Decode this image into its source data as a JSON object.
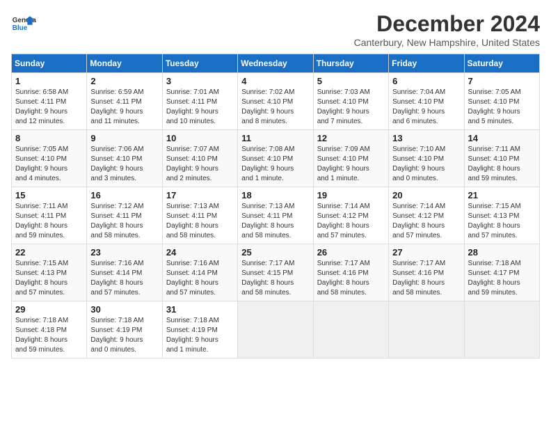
{
  "logo": {
    "line1": "General",
    "line2": "Blue"
  },
  "title": "December 2024",
  "subtitle": "Canterbury, New Hampshire, United States",
  "days_header": [
    "Sunday",
    "Monday",
    "Tuesday",
    "Wednesday",
    "Thursday",
    "Friday",
    "Saturday"
  ],
  "weeks": [
    [
      {
        "day": "1",
        "info": "Sunrise: 6:58 AM\nSunset: 4:11 PM\nDaylight: 9 hours\nand 12 minutes."
      },
      {
        "day": "2",
        "info": "Sunrise: 6:59 AM\nSunset: 4:11 PM\nDaylight: 9 hours\nand 11 minutes."
      },
      {
        "day": "3",
        "info": "Sunrise: 7:01 AM\nSunset: 4:11 PM\nDaylight: 9 hours\nand 10 minutes."
      },
      {
        "day": "4",
        "info": "Sunrise: 7:02 AM\nSunset: 4:10 PM\nDaylight: 9 hours\nand 8 minutes."
      },
      {
        "day": "5",
        "info": "Sunrise: 7:03 AM\nSunset: 4:10 PM\nDaylight: 9 hours\nand 7 minutes."
      },
      {
        "day": "6",
        "info": "Sunrise: 7:04 AM\nSunset: 4:10 PM\nDaylight: 9 hours\nand 6 minutes."
      },
      {
        "day": "7",
        "info": "Sunrise: 7:05 AM\nSunset: 4:10 PM\nDaylight: 9 hours\nand 5 minutes."
      }
    ],
    [
      {
        "day": "8",
        "info": "Sunrise: 7:05 AM\nSunset: 4:10 PM\nDaylight: 9 hours\nand 4 minutes."
      },
      {
        "day": "9",
        "info": "Sunrise: 7:06 AM\nSunset: 4:10 PM\nDaylight: 9 hours\nand 3 minutes."
      },
      {
        "day": "10",
        "info": "Sunrise: 7:07 AM\nSunset: 4:10 PM\nDaylight: 9 hours\nand 2 minutes."
      },
      {
        "day": "11",
        "info": "Sunrise: 7:08 AM\nSunset: 4:10 PM\nDaylight: 9 hours\nand 1 minute."
      },
      {
        "day": "12",
        "info": "Sunrise: 7:09 AM\nSunset: 4:10 PM\nDaylight: 9 hours\nand 1 minute."
      },
      {
        "day": "13",
        "info": "Sunrise: 7:10 AM\nSunset: 4:10 PM\nDaylight: 9 hours\nand 0 minutes."
      },
      {
        "day": "14",
        "info": "Sunrise: 7:11 AM\nSunset: 4:10 PM\nDaylight: 8 hours\nand 59 minutes."
      }
    ],
    [
      {
        "day": "15",
        "info": "Sunrise: 7:11 AM\nSunset: 4:11 PM\nDaylight: 8 hours\nand 59 minutes."
      },
      {
        "day": "16",
        "info": "Sunrise: 7:12 AM\nSunset: 4:11 PM\nDaylight: 8 hours\nand 58 minutes."
      },
      {
        "day": "17",
        "info": "Sunrise: 7:13 AM\nSunset: 4:11 PM\nDaylight: 8 hours\nand 58 minutes."
      },
      {
        "day": "18",
        "info": "Sunrise: 7:13 AM\nSunset: 4:11 PM\nDaylight: 8 hours\nand 58 minutes."
      },
      {
        "day": "19",
        "info": "Sunrise: 7:14 AM\nSunset: 4:12 PM\nDaylight: 8 hours\nand 57 minutes."
      },
      {
        "day": "20",
        "info": "Sunrise: 7:14 AM\nSunset: 4:12 PM\nDaylight: 8 hours\nand 57 minutes."
      },
      {
        "day": "21",
        "info": "Sunrise: 7:15 AM\nSunset: 4:13 PM\nDaylight: 8 hours\nand 57 minutes."
      }
    ],
    [
      {
        "day": "22",
        "info": "Sunrise: 7:15 AM\nSunset: 4:13 PM\nDaylight: 8 hours\nand 57 minutes."
      },
      {
        "day": "23",
        "info": "Sunrise: 7:16 AM\nSunset: 4:14 PM\nDaylight: 8 hours\nand 57 minutes."
      },
      {
        "day": "24",
        "info": "Sunrise: 7:16 AM\nSunset: 4:14 PM\nDaylight: 8 hours\nand 57 minutes."
      },
      {
        "day": "25",
        "info": "Sunrise: 7:17 AM\nSunset: 4:15 PM\nDaylight: 8 hours\nand 58 minutes."
      },
      {
        "day": "26",
        "info": "Sunrise: 7:17 AM\nSunset: 4:16 PM\nDaylight: 8 hours\nand 58 minutes."
      },
      {
        "day": "27",
        "info": "Sunrise: 7:17 AM\nSunset: 4:16 PM\nDaylight: 8 hours\nand 58 minutes."
      },
      {
        "day": "28",
        "info": "Sunrise: 7:18 AM\nSunset: 4:17 PM\nDaylight: 8 hours\nand 59 minutes."
      }
    ],
    [
      {
        "day": "29",
        "info": "Sunrise: 7:18 AM\nSunset: 4:18 PM\nDaylight: 8 hours\nand 59 minutes."
      },
      {
        "day": "30",
        "info": "Sunrise: 7:18 AM\nSunset: 4:19 PM\nDaylight: 9 hours\nand 0 minutes."
      },
      {
        "day": "31",
        "info": "Sunrise: 7:18 AM\nSunset: 4:19 PM\nDaylight: 9 hours\nand 1 minute."
      },
      null,
      null,
      null,
      null
    ]
  ]
}
